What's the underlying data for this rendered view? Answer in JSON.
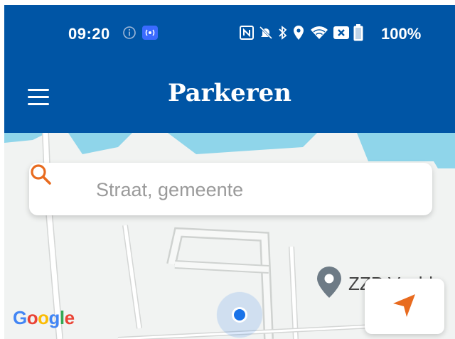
{
  "status_bar": {
    "time": "09:20",
    "battery": "100%",
    "icons": [
      "info-icon",
      "broadcast-icon",
      "nfc-icon",
      "bell-muted-icon",
      "bluetooth-icon",
      "location-icon",
      "wifi-icon",
      "notification-icon",
      "battery-icon"
    ]
  },
  "app_bar": {
    "title": "Parkeren",
    "menu_icon": "hamburger-menu-icon"
  },
  "search": {
    "placeholder": "Straat, gemeente",
    "value": "",
    "icon": "search-icon"
  },
  "map": {
    "poi_label": "ZZP Vasbla",
    "attribution": "Google",
    "user_location_icon": "current-location-dot-icon"
  },
  "locate_button": {
    "icon": "navigation-arrow-icon"
  },
  "colors": {
    "primary": "#0055a5",
    "accent": "#e86b1f",
    "water": "#8fd5ea",
    "road": "#ffffff",
    "land": "#f1f3f2",
    "location_dot": "#1a73e8"
  }
}
